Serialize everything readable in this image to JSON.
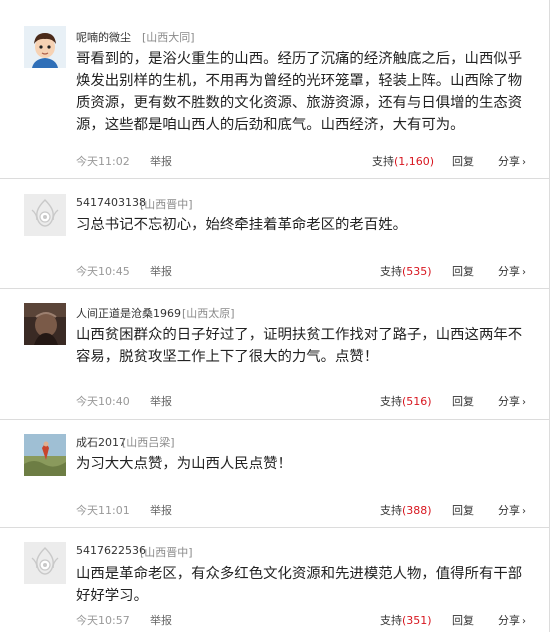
{
  "comments": [
    {
      "username": "呢喃的微尘",
      "location": "[山西大同]",
      "content": "哥看到的，是浴火重生的山西。经历了沉痛的经济触底之后，山西似乎焕发出别样的生机，不用再为曾经的光环笼罩，轻装上阵。山西除了物质资源，更有数不胜数的文化资源、旅游资源，还有与日俱增的生态资源，这些都是咱山西人的后劲和底气。山西经济，大有可为。",
      "time": "今天11:02",
      "report": "举报",
      "support_label": "支持",
      "support_count": "(1,160)",
      "reply": "回复",
      "share": "分享",
      "avatar_icon": "cartoon-boy-avatar"
    },
    {
      "username": "5417403138",
      "location": "[山西晋中]",
      "content": "习总书记不忘初心，始终牵挂着革命老区的老百姓。",
      "time": "今天10:45",
      "report": "举报",
      "support_label": "支持",
      "support_count": "(535)",
      "reply": "回复",
      "share": "分享",
      "avatar_icon": "default-eye-avatar"
    },
    {
      "username": "人间正道是沧桑1969",
      "location": "[山西太原]",
      "content": "山西贫困群众的日子好过了，证明扶贫工作找对了路子，山西这两年不容易，脱贫攻坚工作上下了很大的力气。点赞！",
      "time": "今天10:40",
      "report": "举报",
      "support_label": "支持",
      "support_count": "(516)",
      "reply": "回复",
      "share": "分享",
      "avatar_icon": "dark-photo-avatar"
    },
    {
      "username": "成石2017",
      "location": "[山西吕梁]",
      "content": "为习大大点赞，为山西人民点赞！",
      "time": "今天11:01",
      "report": "举报",
      "support_label": "支持",
      "support_count": "(388)",
      "reply": "回复",
      "share": "分享",
      "avatar_icon": "landscape-photo-avatar"
    },
    {
      "username": "5417622536",
      "location": "[山西晋中]",
      "content": "山西是革命老区，有众多红色文化资源和先进模范人物，值得所有干部好好学习。",
      "time": "今天10:57",
      "report": "举报",
      "support_label": "支持",
      "support_count": "(351)",
      "reply": "回复",
      "share": "分享",
      "avatar_icon": "default-eye-avatar"
    }
  ],
  "colors": {
    "count_red": "#d8161f",
    "divider": "#dcdcdc",
    "meta_gray": "#999999"
  }
}
